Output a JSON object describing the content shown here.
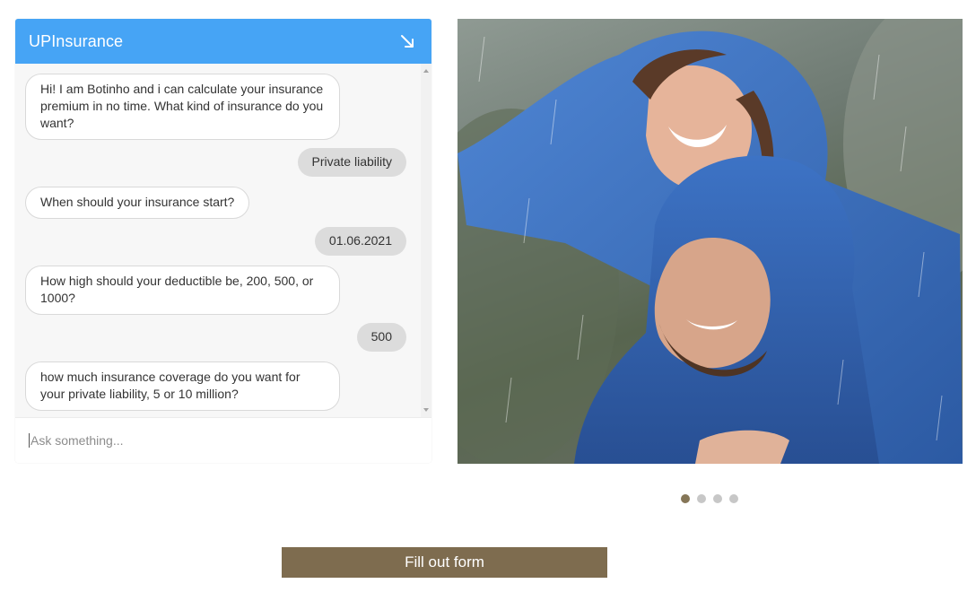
{
  "chat": {
    "title": "UPInsurance",
    "minimize_icon": "arrow-down-right-icon",
    "header_color": "#46a4f5",
    "messages": [
      {
        "from": "bot",
        "text": "Hi! I am Botinho and i can calculate your insurance premium in no time. What kind of insurance do you want?"
      },
      {
        "from": "user",
        "text": "Private liability"
      },
      {
        "from": "bot",
        "text": "When should your insurance start?"
      },
      {
        "from": "user",
        "text": "01.06.2021"
      },
      {
        "from": "bot",
        "text": "How high should your deductible be, 200, 500, or 1000?"
      },
      {
        "from": "user",
        "text": "500"
      },
      {
        "from": "bot",
        "text": "how much insurance coverage do you want for your private liability, 5 or 10 million?"
      }
    ],
    "input": {
      "placeholder": "Ask something...",
      "value": ""
    }
  },
  "carousel": {
    "image_description": "couple-in-rain-photo",
    "slides": 4,
    "active_slide": 1,
    "active_dot_color": "#857657"
  },
  "cta": {
    "label": "Fill out form",
    "color": "#7e6c4f"
  }
}
